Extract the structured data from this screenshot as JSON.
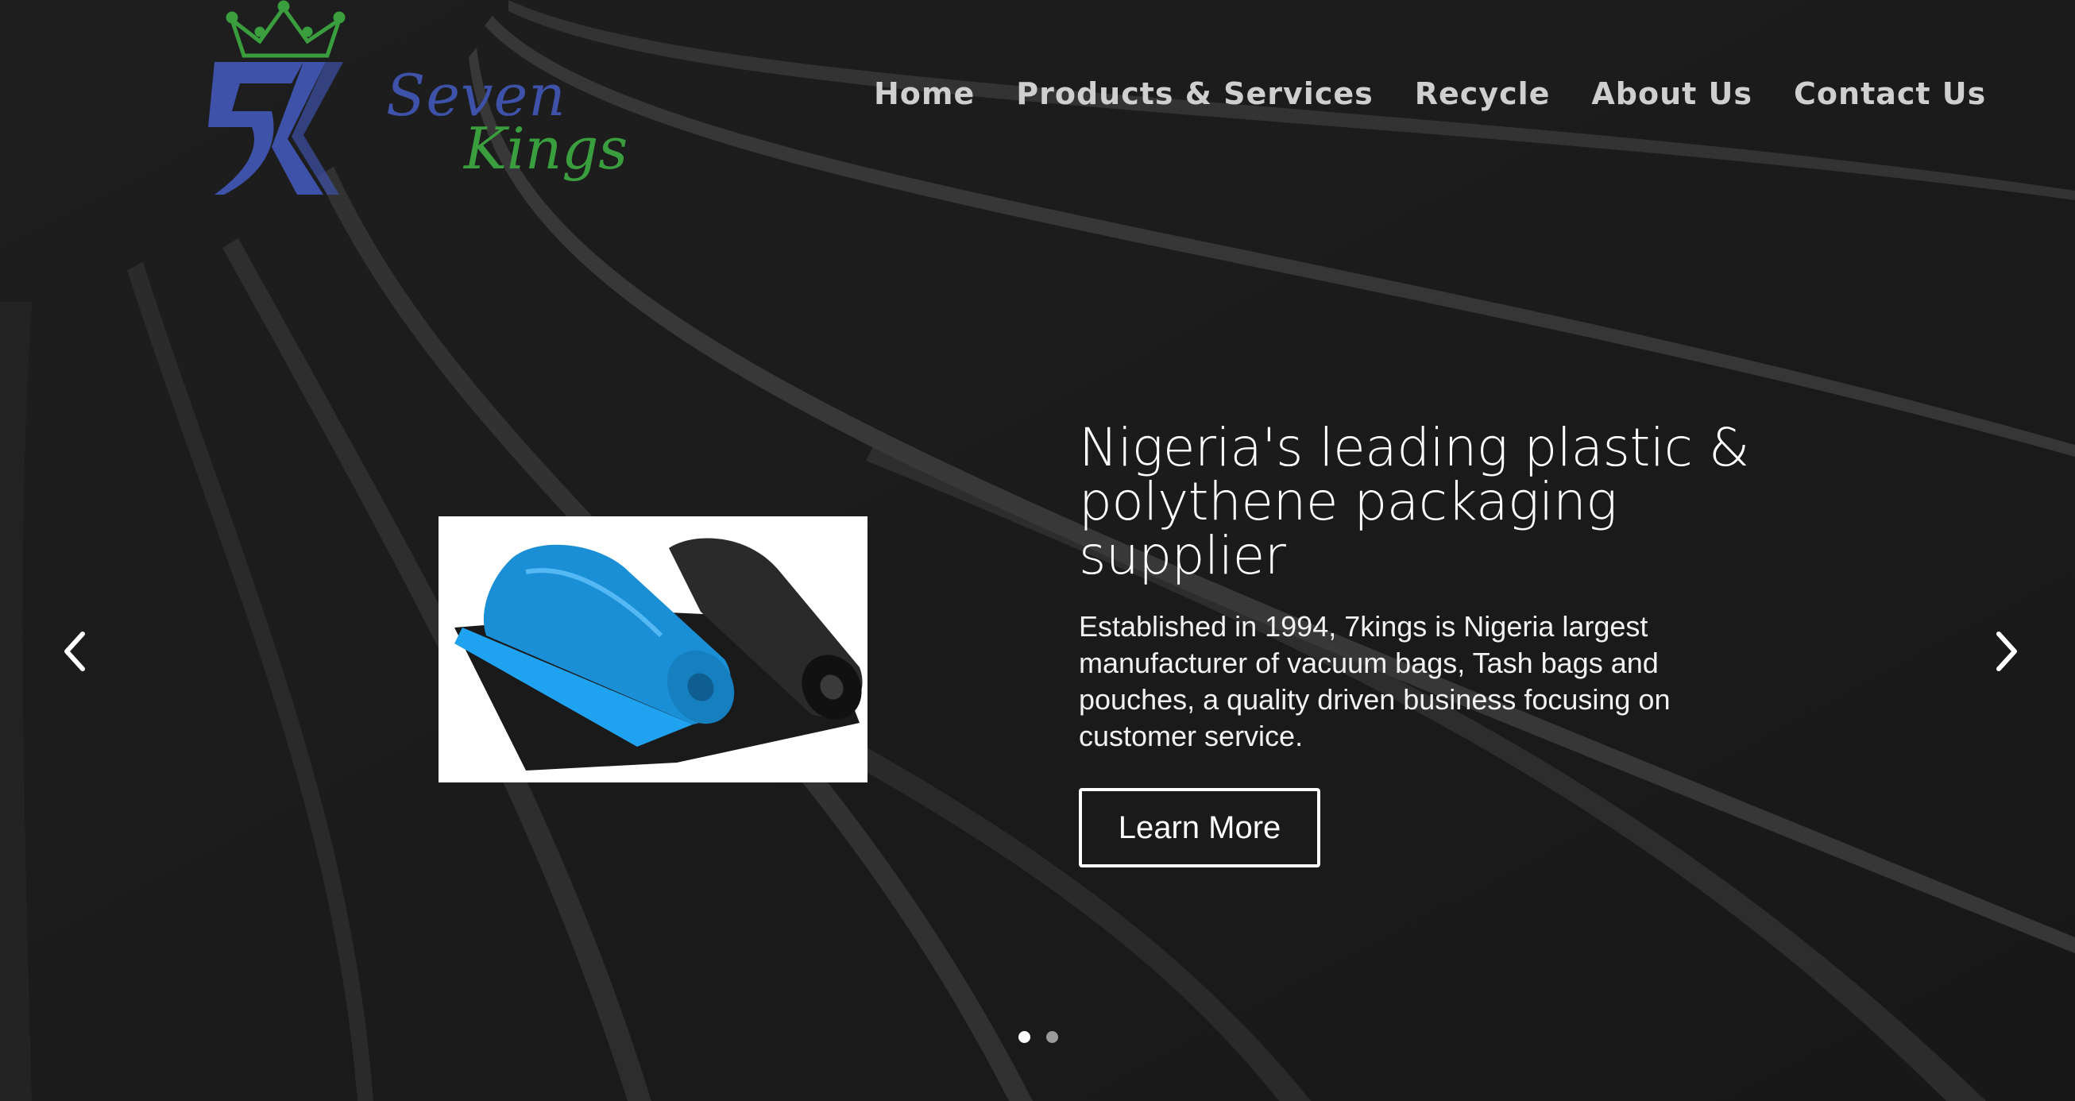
{
  "brand": {
    "name_line1": "Seven",
    "name_line2": "Kings",
    "blue": "#3d52a8",
    "green": "#3a9e3e"
  },
  "nav": {
    "items": [
      "Home",
      "Products & Services",
      "Recycle",
      "About Us",
      "Contact Us"
    ]
  },
  "slide": {
    "headline": "Nigeria's leading plastic & polythene packaging supplier",
    "description": "Established in 1994, 7kings is Nigeria largest manufacturer of vacuum bags, Tash bags and pouches, a quality driven business focusing on customer service.",
    "cta_label": "Learn More",
    "image_subject": "blue-and-black-bag-rolls"
  },
  "carousel": {
    "prev_icon": "chevron-left-icon",
    "next_icon": "chevron-right-icon",
    "slide_count": 2,
    "active_index": 0
  }
}
